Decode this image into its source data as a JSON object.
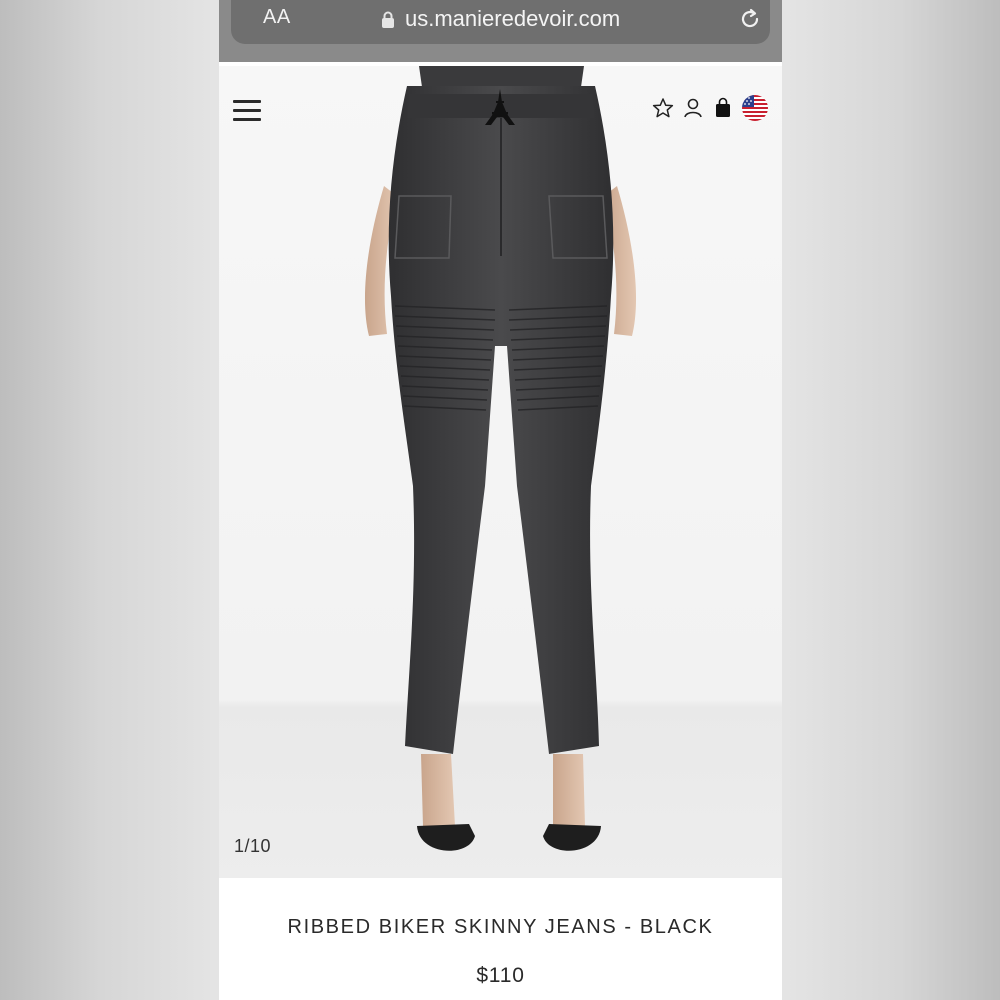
{
  "browser": {
    "text_size_label": "AA",
    "url": "us.manieredevoir.com",
    "lock_icon": "lock-icon",
    "reload_icon": "reload-icon"
  },
  "header": {
    "menu_icon": "hamburger-menu-icon",
    "logo_icon": "eiffel-tower-logo",
    "icons": [
      "star-icon",
      "user-icon",
      "bag-icon",
      "us-flag-icon"
    ]
  },
  "gallery": {
    "counter": "1/10"
  },
  "product": {
    "title": "RIBBED BIKER SKINNY JEANS - BLACK",
    "price": "$110"
  },
  "colors": {
    "browser_bar": "#8a8a8a",
    "url_pill": "#6f6f6f",
    "text": "#2a2a2a",
    "denim": "#3d3d3f"
  }
}
